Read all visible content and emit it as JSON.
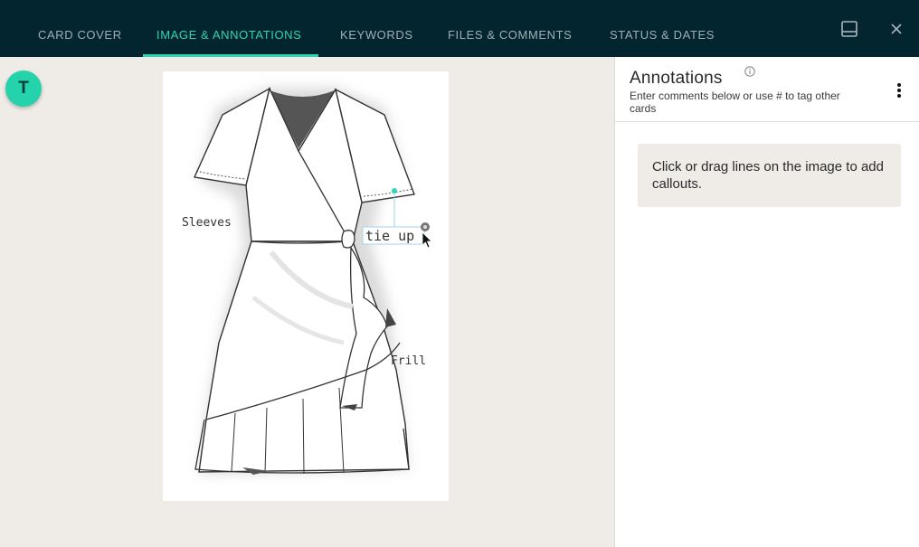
{
  "header": {
    "tabs": [
      {
        "label": "CARD COVER",
        "active": false
      },
      {
        "label": "IMAGE & ANNOTATIONS",
        "active": true
      },
      {
        "label": "KEYWORDS",
        "active": false
      },
      {
        "label": "FILES & COMMENTS",
        "active": false
      },
      {
        "label": "STATUS & DATES",
        "active": false
      }
    ],
    "icons": [
      "panel-layout-icon",
      "close-icon"
    ]
  },
  "user": {
    "avatar_initial": "T"
  },
  "image": {
    "labels": {
      "sleeves": "Sleeves",
      "tie_up": "tie up",
      "frill": "Frill"
    }
  },
  "annotations": {
    "title": "Annotations",
    "subtitle": "Enter comments below or use # to tag other cards",
    "hint": "Click or drag lines on the image to add callouts."
  },
  "colors": {
    "topbar": "#032530",
    "accent": "#2fd6b4",
    "avatar": "#24d2ab",
    "background": "#efece7"
  }
}
